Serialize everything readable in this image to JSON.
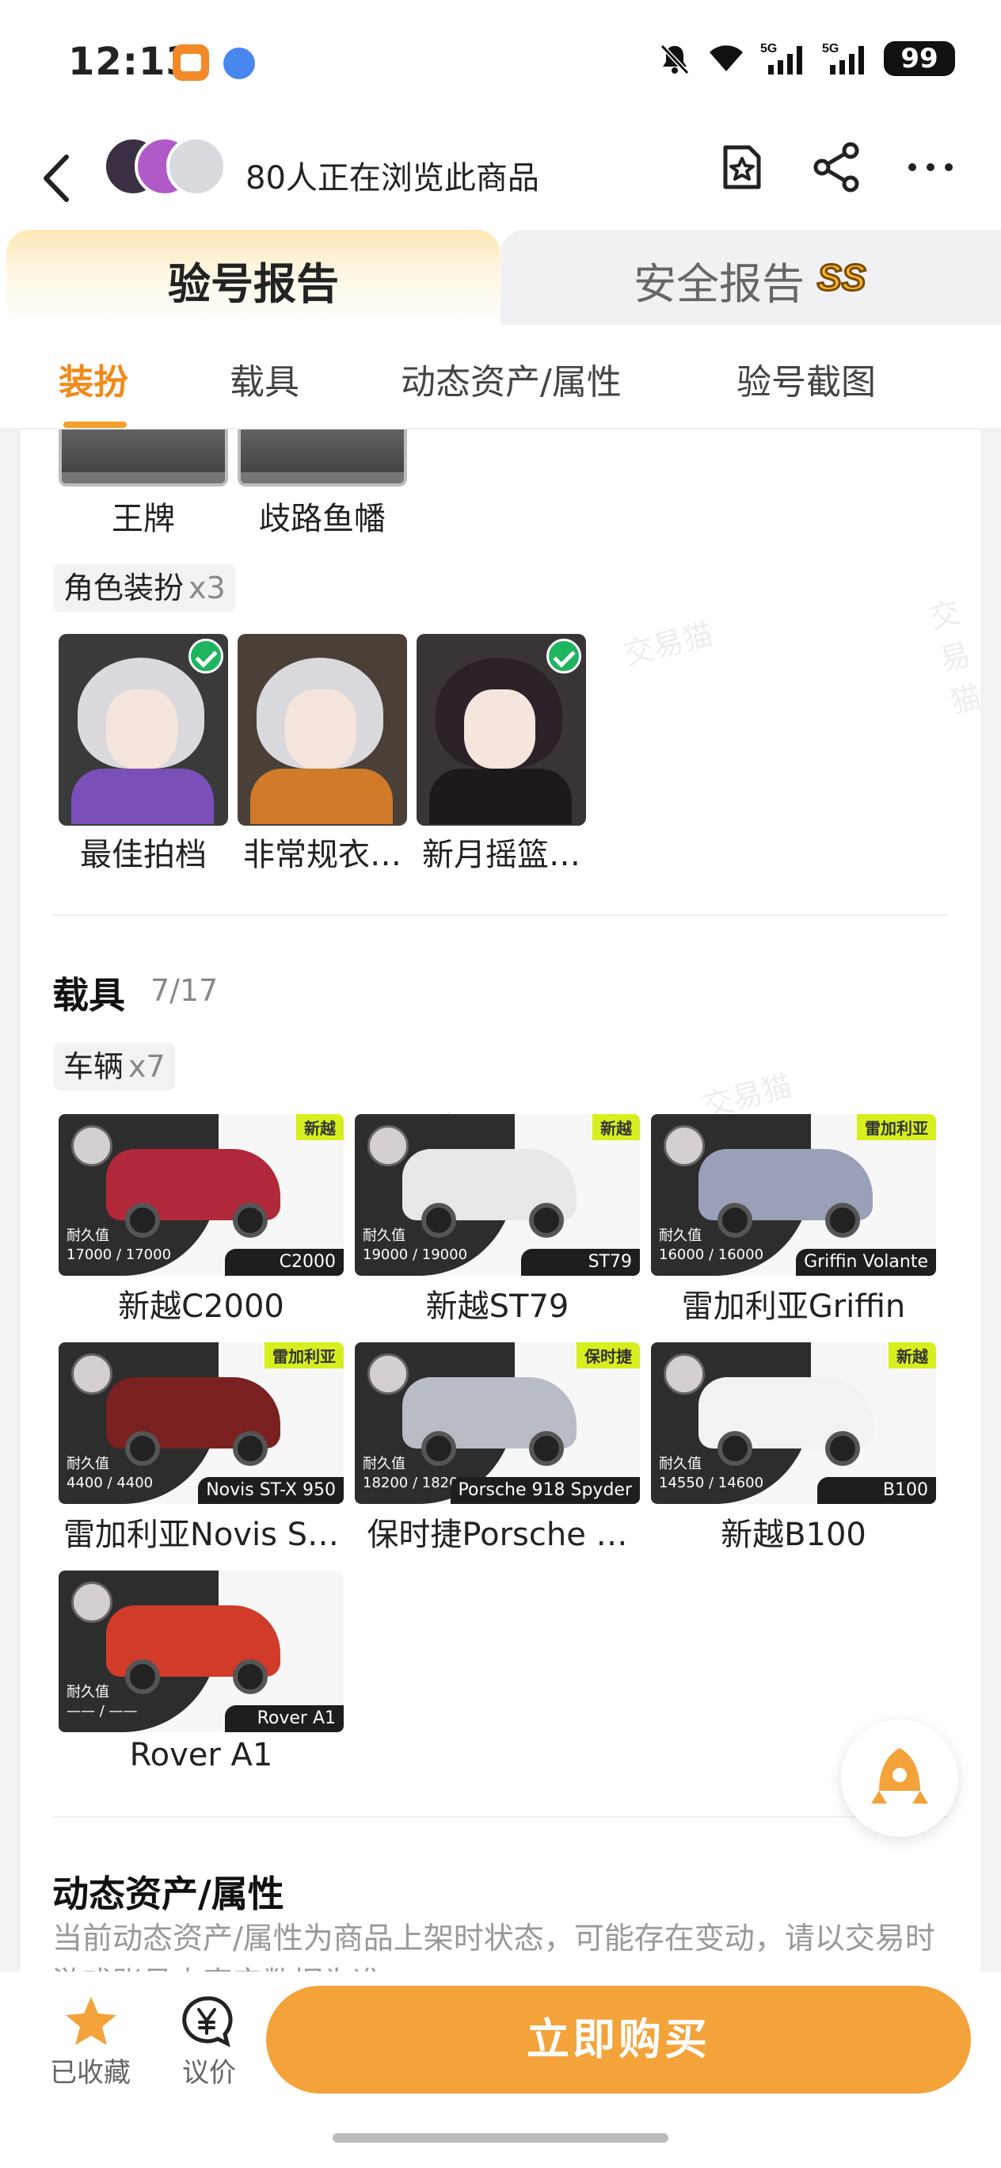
{
  "status_bar": {
    "time": "12:13",
    "battery": "99",
    "net1": "5G",
    "net2": "5G"
  },
  "header": {
    "viewer_text": "80人正在浏览此商品"
  },
  "report_tabs": {
    "inspection": "验号报告",
    "security": "安全报告",
    "security_badge": "SS"
  },
  "sub_tabs": [
    "装扮",
    "载具",
    "动态资产/属性",
    "验号截图"
  ],
  "emblems": [
    {
      "label": "王牌"
    },
    {
      "label": "歧路鱼幡"
    }
  ],
  "outfits": {
    "chip_label": "角色装扮",
    "chip_count": "x3",
    "items": [
      {
        "label": "最佳拍档",
        "checked": true
      },
      {
        "label": "非常规衣…",
        "checked": false
      },
      {
        "label": "新月摇篮…",
        "checked": true
      }
    ]
  },
  "vehicles": {
    "title": "载具",
    "count": "7/17",
    "chip_label": "车辆",
    "chip_count": "x7",
    "durability_label": "耐久值",
    "items": [
      {
        "label": "新越C2000",
        "brand": "新越",
        "durability": "17000 / 17000",
        "model": "C2000",
        "color": "#b0283a"
      },
      {
        "label": "新越ST79",
        "brand": "新越",
        "durability": "19000 / 19000",
        "model": "ST79",
        "color": "#e8e8e8"
      },
      {
        "label": "雷加利亚Griffin",
        "brand": "雷加利亚",
        "durability": "16000 / 16000",
        "model": "Griffin Volante",
        "color": "#9aa0b8"
      },
      {
        "label": "雷加利亚Novis S…",
        "brand": "雷加利亚",
        "durability": "4400 / 4400",
        "model": "Novis ST-X 950",
        "color": "#7a2020"
      },
      {
        "label": "保时捷Porsche …",
        "brand": "保时捷",
        "durability": "18200 / 18200",
        "model": "Porsche 918 Spyder",
        "color": "#b8bcc4"
      },
      {
        "label": "新越B100",
        "brand": "新越",
        "durability": "14550 / 14600",
        "model": "B100",
        "color": "#f2f2f2"
      },
      {
        "label": "Rover A1",
        "brand": "",
        "durability": "—— / ——",
        "model": "Rover A1",
        "color": "#d23a2a"
      }
    ]
  },
  "dynamic": {
    "title": "动态资产/属性",
    "desc": "当前动态资产/属性为商品上架时状态，可能存在变动，请以交易时游戏账号内真实数据为准"
  },
  "watermark": "交易猫",
  "bottom_bar": {
    "favorite_label": "已收藏",
    "bargain_label": "议价",
    "buy_label": "立即购买"
  },
  "colors": {
    "accent": "#f3a33a",
    "active_tab": "#f08a1a"
  }
}
